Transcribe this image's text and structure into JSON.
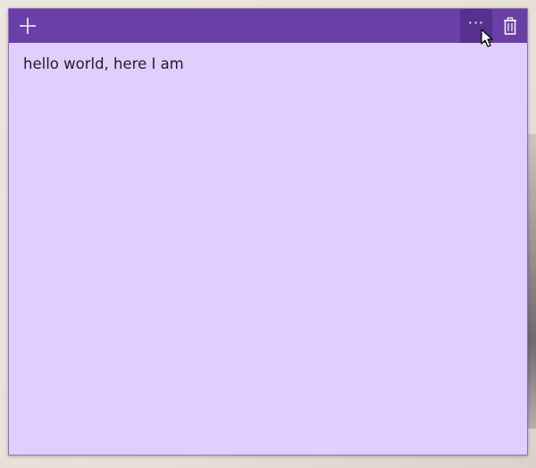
{
  "toolbar": {
    "add_icon": "plus-icon",
    "menu_icon": "ellipsis-icon",
    "menu_label": "···",
    "delete_icon": "trash-icon"
  },
  "note": {
    "text": "hello world, here I am",
    "background_color": "#e1cdfe",
    "titlebar_color": "#6a3fa8"
  }
}
